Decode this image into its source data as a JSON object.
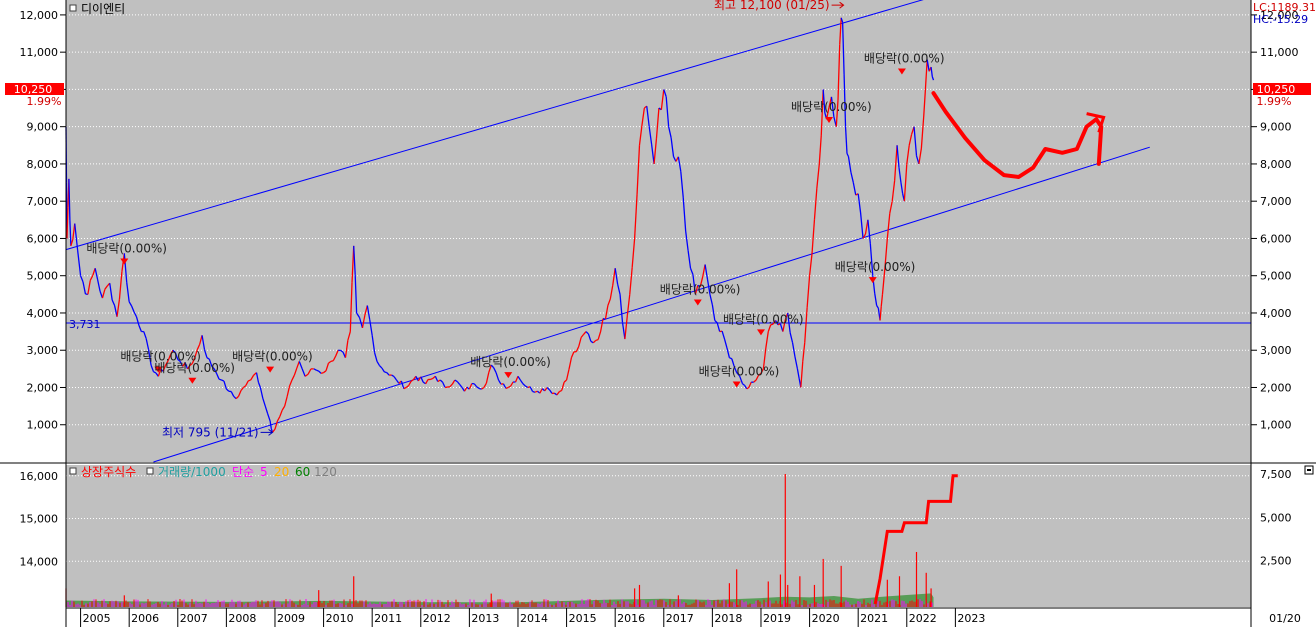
{
  "colors": {
    "panel_bg": "#c0c0c0",
    "up_color": "#ff0000",
    "down_color": "#0000ff",
    "trendline_color": "#0000ff",
    "drawing_color": "#ff0000",
    "price_badge_bg": "#ff0000",
    "ma5": "#ff00ff",
    "ma20": "#ffb000",
    "ma60": "#008000",
    "ma120": "#808080",
    "listed_shares_color": "#ff0000",
    "volume_color": "#20a0a0"
  },
  "main_chart": {
    "title": "디이엔티",
    "y_ticks": [
      "1,000",
      "2,000",
      "3,000",
      "4,000",
      "5,000",
      "6,000",
      "7,000",
      "8,000",
      "9,000",
      "10,000",
      "11,000",
      "12,000"
    ],
    "y_range": [
      0,
      12400
    ],
    "price_label": "10,250",
    "change_label": "1.99%",
    "lc_label": "LC:1189.31",
    "hc_label": "HC:-15.29",
    "support_label": "3,731",
    "support_value": 3731,
    "high_annotation": "최고 12,100 (01/25)",
    "high_value": 12100,
    "low_annotation": "최저 795 (11/21)",
    "low_value": 795,
    "dividend_labels": [
      {
        "text": "배당락(0.00%)",
        "date": 2005.9,
        "price": 5300
      },
      {
        "text": "배당락(0.00%)",
        "date": 2006.6,
        "price": 2400
      },
      {
        "text": "배당락(0.00%)",
        "date": 2007.3,
        "price": 2100
      },
      {
        "text": "배당락(0.00%)",
        "date": 2008.9,
        "price": 2400
      },
      {
        "text": "배당락(0.00%)",
        "date": 2013.8,
        "price": 2250
      },
      {
        "text": "배당락(0.00%)",
        "date": 2017.7,
        "price": 4200
      },
      {
        "text": "배당락(0.00%)",
        "date": 2018.5,
        "price": 2000
      },
      {
        "text": "배당락(0.00%)",
        "date": 2019.0,
        "price": 3400
      },
      {
        "text": "배당락(0.00%)",
        "date": 2020.4,
        "price": 9100
      },
      {
        "text": "배당락(0.00%)",
        "date": 2021.3,
        "price": 4800
      },
      {
        "text": "배당락(0.00%)",
        "date": 2021.9,
        "price": 10400
      }
    ],
    "price_path": [
      [
        2004.7,
        9000
      ],
      [
        2004.72,
        6000
      ],
      [
        2004.76,
        7600
      ],
      [
        2004.8,
        5800
      ],
      [
        2004.88,
        6400
      ],
      [
        2005.0,
        5000
      ],
      [
        2005.15,
        4500
      ],
      [
        2005.3,
        5200
      ],
      [
        2005.45,
        4400
      ],
      [
        2005.6,
        4800
      ],
      [
        2005.75,
        3900
      ],
      [
        2005.9,
        5600
      ],
      [
        2006.0,
        4300
      ],
      [
        2006.15,
        3900
      ],
      [
        2006.3,
        3500
      ],
      [
        2006.45,
        2600
      ],
      [
        2006.6,
        2300
      ],
      [
        2006.75,
        2600
      ],
      [
        2006.9,
        3000
      ],
      [
        2007.05,
        2700
      ],
      [
        2007.2,
        2500
      ],
      [
        2007.35,
        2800
      ],
      [
        2007.5,
        3400
      ],
      [
        2007.6,
        2800
      ],
      [
        2007.75,
        2500
      ],
      [
        2007.9,
        2200
      ],
      [
        2008.05,
        1900
      ],
      [
        2008.2,
        1700
      ],
      [
        2008.35,
        2000
      ],
      [
        2008.5,
        2200
      ],
      [
        2008.62,
        2400
      ],
      [
        2008.7,
        2000
      ],
      [
        2008.8,
        1500
      ],
      [
        2008.9,
        1100
      ],
      [
        2008.95,
        800
      ],
      [
        2009.05,
        1100
      ],
      [
        2009.2,
        1500
      ],
      [
        2009.35,
        2200
      ],
      [
        2009.5,
        2700
      ],
      [
        2009.62,
        2300
      ],
      [
        2009.8,
        2500
      ],
      [
        2010.0,
        2400
      ],
      [
        2010.15,
        2700
      ],
      [
        2010.3,
        3000
      ],
      [
        2010.45,
        2800
      ],
      [
        2010.55,
        3500
      ],
      [
        2010.62,
        5800
      ],
      [
        2010.68,
        4000
      ],
      [
        2010.8,
        3600
      ],
      [
        2010.9,
        4200
      ],
      [
        2011.0,
        3400
      ],
      [
        2011.1,
        2700
      ],
      [
        2011.3,
        2400
      ],
      [
        2011.5,
        2200
      ],
      [
        2011.7,
        2000
      ],
      [
        2011.9,
        2300
      ],
      [
        2012.1,
        2100
      ],
      [
        2012.3,
        2300
      ],
      [
        2012.5,
        2000
      ],
      [
        2012.7,
        2200
      ],
      [
        2012.9,
        1900
      ],
      [
        2013.1,
        2100
      ],
      [
        2013.3,
        2000
      ],
      [
        2013.45,
        2600
      ],
      [
        2013.6,
        2200
      ],
      [
        2013.8,
        2000
      ],
      [
        2014.0,
        2300
      ],
      [
        2014.2,
        2000
      ],
      [
        2014.4,
        1900
      ],
      [
        2014.6,
        2000
      ],
      [
        2014.8,
        1800
      ],
      [
        2015.0,
        2200
      ],
      [
        2015.1,
        2800
      ],
      [
        2015.25,
        3100
      ],
      [
        2015.4,
        3500
      ],
      [
        2015.55,
        3200
      ],
      [
        2015.7,
        3500
      ],
      [
        2015.85,
        4200
      ],
      [
        2016.0,
        5200
      ],
      [
        2016.1,
        4500
      ],
      [
        2016.2,
        3300
      ],
      [
        2016.3,
        4500
      ],
      [
        2016.4,
        6000
      ],
      [
        2016.5,
        8500
      ],
      [
        2016.6,
        9500
      ],
      [
        2016.7,
        9000
      ],
      [
        2016.8,
        8000
      ],
      [
        2016.9,
        9500
      ],
      [
        2017.0,
        10000
      ],
      [
        2017.1,
        9000
      ],
      [
        2017.2,
        8200
      ],
      [
        2017.35,
        7800
      ],
      [
        2017.45,
        6200
      ],
      [
        2017.55,
        5200
      ],
      [
        2017.65,
        4500
      ],
      [
        2017.75,
        4700
      ],
      [
        2017.85,
        5300
      ],
      [
        2017.95,
        4500
      ],
      [
        2018.05,
        3800
      ],
      [
        2018.15,
        3500
      ],
      [
        2018.25,
        3300
      ],
      [
        2018.35,
        2800
      ],
      [
        2018.5,
        2400
      ],
      [
        2018.62,
        2100
      ],
      [
        2018.75,
        2000
      ],
      [
        2018.9,
        2200
      ],
      [
        2019.05,
        2500
      ],
      [
        2019.15,
        3500
      ],
      [
        2019.3,
        3800
      ],
      [
        2019.45,
        3500
      ],
      [
        2019.55,
        4000
      ],
      [
        2019.65,
        3200
      ],
      [
        2019.75,
        2500
      ],
      [
        2019.82,
        2000
      ],
      [
        2019.9,
        3200
      ],
      [
        2020.0,
        5000
      ],
      [
        2020.1,
        6500
      ],
      [
        2020.2,
        8000
      ],
      [
        2020.28,
        10000
      ],
      [
        2020.35,
        9200
      ],
      [
        2020.45,
        9800
      ],
      [
        2020.55,
        9000
      ],
      [
        2020.62,
        11200
      ],
      [
        2020.68,
        11800
      ],
      [
        2020.74,
        9000
      ],
      [
        2020.8,
        8200
      ],
      [
        2020.9,
        7500
      ],
      [
        2021.0,
        7200
      ],
      [
        2021.1,
        6000
      ],
      [
        2021.2,
        6500
      ],
      [
        2021.3,
        5000
      ],
      [
        2021.38,
        4200
      ],
      [
        2021.45,
        3800
      ],
      [
        2021.5,
        4500
      ],
      [
        2021.6,
        6000
      ],
      [
        2021.7,
        7000
      ],
      [
        2021.8,
        8500
      ],
      [
        2021.88,
        7500
      ],
      [
        2021.95,
        7000
      ],
      [
        2022.05,
        8500
      ],
      [
        2022.15,
        9000
      ],
      [
        2022.25,
        8000
      ],
      [
        2022.35,
        9300
      ],
      [
        2022.42,
        10800
      ],
      [
        2022.5,
        10600
      ],
      [
        2022.55,
        10250
      ]
    ],
    "upper_trendline": [
      [
        2004.7,
        5700
      ],
      [
        2023.1,
        12700
      ]
    ],
    "lower_trendline": [
      [
        2006.5,
        0
      ],
      [
        2027.0,
        8450
      ]
    ],
    "forecast_drawing": [
      [
        2022.55,
        9900
      ],
      [
        2022.8,
        9400
      ],
      [
        2023.2,
        8700
      ],
      [
        2023.6,
        8100
      ],
      [
        2024.0,
        7700
      ],
      [
        2024.3,
        7650
      ],
      [
        2024.6,
        7900
      ],
      [
        2024.85,
        8400
      ],
      [
        2025.2,
        8300
      ],
      [
        2025.5,
        8400
      ],
      [
        2025.7,
        9000
      ],
      [
        2025.9,
        9200
      ],
      [
        2026.0,
        9000
      ],
      [
        2025.95,
        8000
      ]
    ],
    "forecast_arrowhead": [
      [
        2025.7,
        9350
      ],
      [
        2026.05,
        9250
      ],
      [
        2025.95,
        8850
      ]
    ]
  },
  "volume_chart": {
    "legend": [
      "상장주식수",
      "거래량/1000",
      "단순",
      "5",
      "20",
      "60",
      "120"
    ],
    "left_ticks": [
      "14,000",
      "15,000",
      "16,000"
    ],
    "right_ticks": [
      "2,500",
      "5,000",
      "7,500"
    ],
    "listed_shares_path": [
      [
        2021.35,
        13000
      ],
      [
        2021.45,
        13600
      ],
      [
        2021.6,
        14700
      ],
      [
        2021.9,
        14700
      ],
      [
        2021.95,
        14900
      ],
      [
        2022.4,
        14900
      ],
      [
        2022.45,
        15400
      ],
      [
        2022.9,
        15400
      ],
      [
        2022.95,
        16000
      ],
      [
        2023.05,
        16000
      ]
    ],
    "volume_spikes": [
      [
        2004.7,
        900
      ],
      [
        2005.9,
        500
      ],
      [
        2009.9,
        800
      ],
      [
        2010.62,
        1600
      ],
      [
        2013.45,
        600
      ],
      [
        2016.4,
        900
      ],
      [
        2016.5,
        1100
      ],
      [
        2017.3,
        500
      ],
      [
        2018.35,
        1200
      ],
      [
        2018.5,
        2000
      ],
      [
        2019.15,
        1300
      ],
      [
        2019.4,
        1700
      ],
      [
        2019.5,
        7500
      ],
      [
        2019.55,
        1100
      ],
      [
        2019.8,
        1600
      ],
      [
        2020.1,
        1100
      ],
      [
        2020.28,
        2600
      ],
      [
        2020.65,
        2200
      ],
      [
        2021.6,
        1400
      ],
      [
        2021.85,
        1600
      ],
      [
        2022.2,
        3000
      ],
      [
        2022.4,
        1800
      ],
      [
        2022.5,
        900
      ]
    ],
    "volume_baseline": [
      [
        2004.7,
        200
      ],
      [
        2006.0,
        150
      ],
      [
        2008.0,
        120
      ],
      [
        2010.0,
        180
      ],
      [
        2012.0,
        110
      ],
      [
        2014.0,
        100
      ],
      [
        2016.0,
        260
      ],
      [
        2017.0,
        300
      ],
      [
        2018.0,
        230
      ],
      [
        2019.0,
        340
      ],
      [
        2019.5,
        420
      ],
      [
        2020.0,
        380
      ],
      [
        2020.5,
        460
      ],
      [
        2021.0,
        300
      ],
      [
        2021.5,
        420
      ],
      [
        2022.0,
        520
      ],
      [
        2022.5,
        610
      ],
      [
        2022.55,
        380
      ]
    ]
  },
  "x_axis": {
    "labels": [
      "2005",
      "2006",
      "2007",
      "2008",
      "2009",
      "2010",
      "2011",
      "2012",
      "2013",
      "2014",
      "2015",
      "2016",
      "2017",
      "2018",
      "2019",
      "2020",
      "2021",
      "2022",
      "2023"
    ],
    "right_label": "01/20"
  }
}
